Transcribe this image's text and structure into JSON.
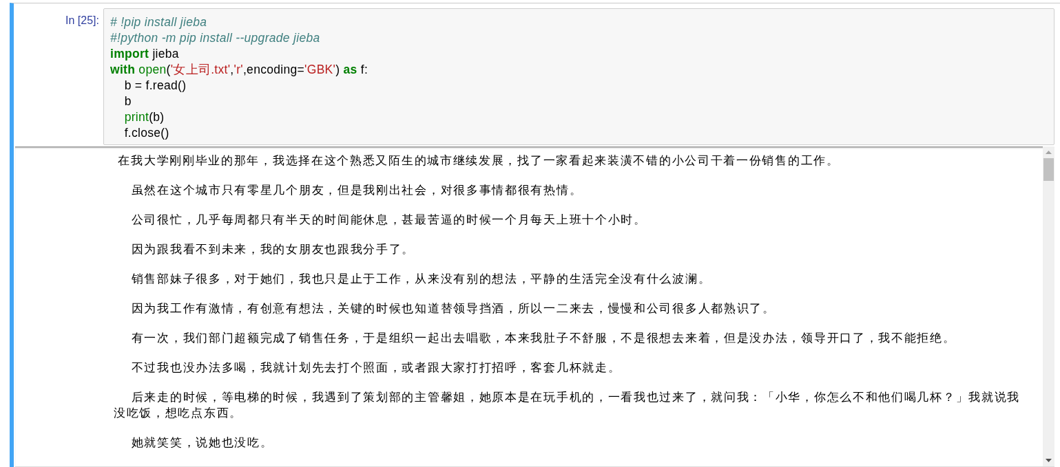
{
  "cell": {
    "prompt": "In [25]:",
    "code_lines": [
      [
        {
          "kind": "comment",
          "text": "# !pip install jieba"
        }
      ],
      [
        {
          "kind": "comment",
          "text": "#!python -m pip install --upgrade jieba"
        }
      ],
      [
        {
          "kind": "keyword",
          "text": "import"
        },
        {
          "kind": "plain",
          "text": " jieba"
        }
      ],
      [
        {
          "kind": "keyword",
          "text": "with"
        },
        {
          "kind": "builtin",
          "text": " open"
        },
        {
          "kind": "plain",
          "text": "("
        },
        {
          "kind": "string",
          "text": "'女上司.txt'"
        },
        {
          "kind": "plain",
          "text": ","
        },
        {
          "kind": "string",
          "text": "'r'"
        },
        {
          "kind": "plain",
          "text": ",encoding="
        },
        {
          "kind": "string",
          "text": "'GBK'"
        },
        {
          "kind": "plain",
          "text": ") "
        },
        {
          "kind": "keyword",
          "text": "as"
        },
        {
          "kind": "plain",
          "text": " f:"
        }
      ],
      [
        {
          "kind": "plain",
          "text": "    b = f.read()"
        }
      ],
      [
        {
          "kind": "plain",
          "text": "    b"
        }
      ],
      [
        {
          "kind": "builtin",
          "text": "    print"
        },
        {
          "kind": "plain",
          "text": "(b)"
        }
      ],
      [
        {
          "kind": "plain",
          "text": "    f.close()"
        }
      ]
    ],
    "output_paragraphs": [
      " 在我大学刚刚毕业的那年，我选择在这个熟悉又陌生的城市继续发展，找了一家看起来装潢不错的小公司干着一份销售的工作。",
      "    虽然在这个城市只有零星几个朋友，但是我刚出社会，对很多事情都很有热情。",
      "    公司很忙，几乎每周都只有半天的时间能休息，甚最苦逼的时候一个月每天上班十个小时。",
      "    因为跟我看不到未来，我的女朋友也跟我分手了。",
      "    销售部妹子很多，对于她们，我也只是止于工作，从来没有别的想法，平静的生活完全没有什么波澜。",
      "    因为我工作有激情，有创意有想法，关键的时候也知道替领导挡酒，所以一二来去，慢慢和公司很多人都熟识了。",
      "    有一次，我们部门超额完成了销售任务，于是组织一起出去唱歌，本来我肚子不舒服，不是很想去来着，但是没办法，领导开口了，我不能拒绝。",
      "    不过我也没办法多喝，我就计划先去打个照面，或者跟大家打打招呼，客套几杯就走。",
      "    后来走的时候，等电梯的时候，我遇到了策划部的主管馨姐，她原本是在玩手机的，一看我也过来了，就问我：「小华，你怎么不和他们喝几杯？」我就说我没吃饭，想吃点东西。",
      "    她就笑笑，说她也没吃。"
    ]
  }
}
